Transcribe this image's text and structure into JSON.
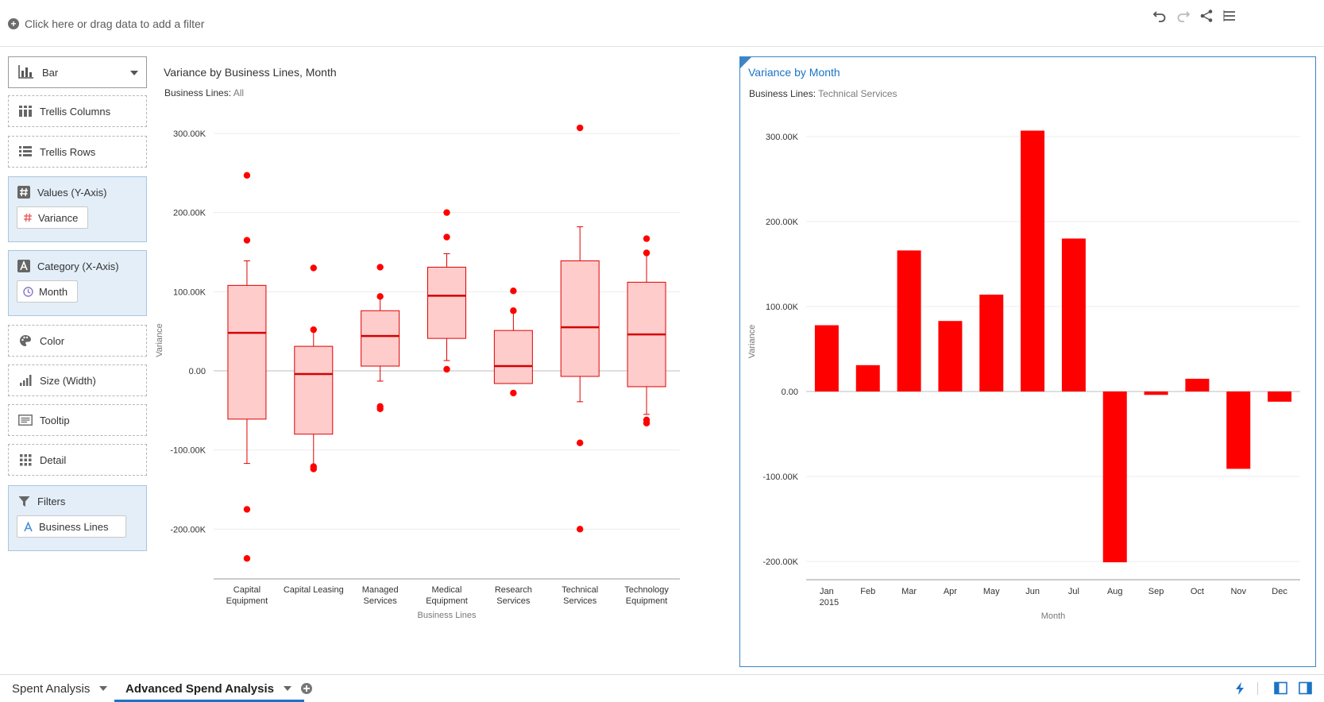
{
  "filter_bar": {
    "hint": "Click here or drag data to add a filter"
  },
  "toolbar": {
    "icons": [
      "undo-icon",
      "redo-icon",
      "share-icon",
      "menu-icon"
    ]
  },
  "grammar": {
    "chart_type": "Bar",
    "trellis_columns": "Trellis Columns",
    "trellis_rows": "Trellis Rows",
    "values_label": "Values (Y-Axis)",
    "values_item": "Variance",
    "category_label": "Category (X-Axis)",
    "category_item": "Month",
    "color": "Color",
    "size": "Size (Width)",
    "tooltip": "Tooltip",
    "detail": "Detail",
    "filters_label": "Filters",
    "filters_item": "Business Lines"
  },
  "viz1": {
    "title": "Variance by Business Lines, Month",
    "filter_label": "Business Lines:",
    "filter_value": "All"
  },
  "viz2": {
    "title": "Variance by Month",
    "filter_label": "Business Lines:",
    "filter_value": "Technical Services"
  },
  "chart_data": [
    {
      "type": "box",
      "title": "Variance by Business Lines, Month",
      "xlabel": "Business Lines",
      "ylabel": "Variance",
      "ylim": [
        -260000,
        300000
      ],
      "yticks": [
        300000,
        200000,
        100000,
        0,
        -100000,
        -200000
      ],
      "ytick_labels": [
        "300.00K",
        "200.00K",
        "100.00K",
        "0.00",
        "-100.00K",
        "-200.00K"
      ],
      "color": "#ff0000",
      "categories": [
        {
          "label": [
            "Capital",
            "Equipment"
          ],
          "whisker_low": -117000,
          "q1": -61000,
          "median": 48000,
          "q3": 108000,
          "whisker_high": 139000,
          "outliers": [
            247000,
            165000,
            -175000,
            -237000
          ]
        },
        {
          "label": [
            "Capital Leasing"
          ],
          "whisker_low": -121000,
          "q1": -80000,
          "median": -4000,
          "q3": 31000,
          "whisker_high": 52000,
          "outliers": [
            130000,
            52000,
            -121000,
            -124000
          ]
        },
        {
          "label": [
            "Managed",
            "Services"
          ],
          "whisker_low": -13000,
          "q1": 6000,
          "median": 44000,
          "q3": 76000,
          "whisker_high": 94000,
          "outliers": [
            131000,
            94000,
            -45000,
            -48000
          ]
        },
        {
          "label": [
            "Medical",
            "Equipment"
          ],
          "whisker_low": 13000,
          "q1": 41000,
          "median": 95000,
          "q3": 131000,
          "whisker_high": 148000,
          "outliers": [
            200000,
            169000,
            2000
          ]
        },
        {
          "label": [
            "Research",
            "Services"
          ],
          "whisker_low": -16000,
          "q1": -16000,
          "median": 6000,
          "q3": 51000,
          "whisker_high": 76000,
          "outliers": [
            101000,
            76000,
            -28000
          ]
        },
        {
          "label": [
            "Technical",
            "Services"
          ],
          "whisker_low": -39000,
          "q1": -7000,
          "median": 55000,
          "q3": 139000,
          "whisker_high": 182000,
          "outliers": [
            307000,
            -91000,
            -200000
          ]
        },
        {
          "label": [
            "Technology",
            "Equipment"
          ],
          "whisker_low": -55000,
          "q1": -20000,
          "median": 46000,
          "q3": 112000,
          "whisker_high": 148000,
          "outliers": [
            167000,
            149000,
            -62000,
            -66000
          ]
        }
      ]
    },
    {
      "type": "bar",
      "title": "Variance by Month",
      "xlabel": "Month",
      "ylabel": "Variance",
      "ylim": [
        -220000,
        325000
      ],
      "yticks": [
        300000,
        200000,
        100000,
        0,
        -100000,
        -200000
      ],
      "ytick_labels": [
        "300.00K",
        "200.00K",
        "100.00K",
        "0.00",
        "-100.00K",
        "-200.00K"
      ],
      "color": "#ff0000",
      "categories": [
        "Jan",
        "Feb",
        "Mar",
        "Apr",
        "May",
        "Jun",
        "Jul",
        "Aug",
        "Sep",
        "Oct",
        "Nov",
        "Dec"
      ],
      "category_sublabel": {
        "Jan": "2015"
      },
      "values": [
        78000,
        31000,
        166000,
        83000,
        114000,
        307000,
        180000,
        -201000,
        -4000,
        15000,
        -91000,
        -12000
      ]
    }
  ],
  "bottom_tabs": [
    {
      "label": "Spent Analysis",
      "active": false
    },
    {
      "label": "Advanced Spend Analysis",
      "active": true
    }
  ]
}
